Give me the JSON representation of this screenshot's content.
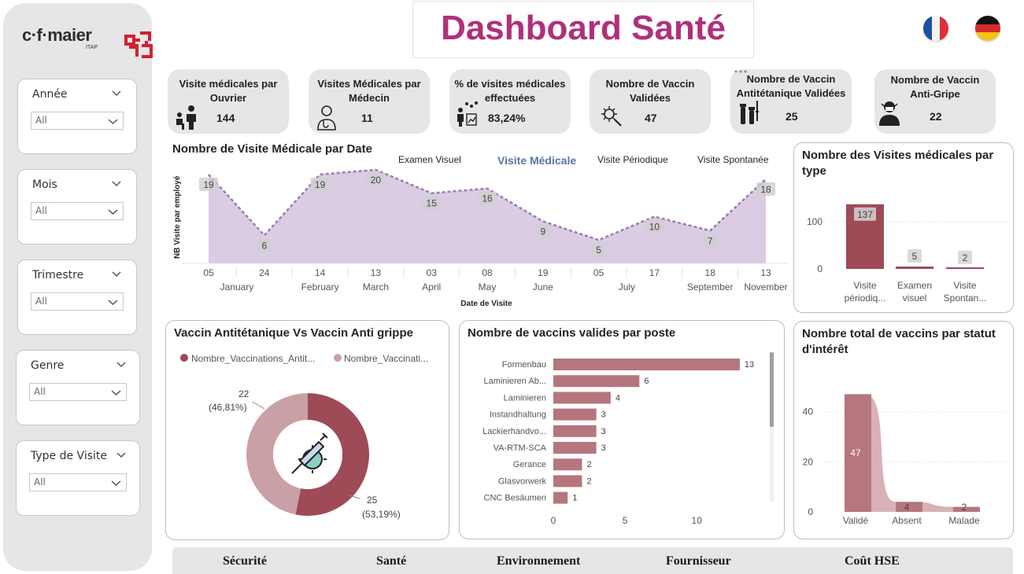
{
  "logo": {
    "brand": "c·f·maier",
    "sub": "ITAP"
  },
  "header": {
    "title": "Dashboard Santé",
    "flags": [
      "france-flag",
      "germany-flag"
    ]
  },
  "filters": [
    {
      "label": "Année",
      "value": "All"
    },
    {
      "label": "Mois",
      "value": "All"
    },
    {
      "label": "Trimestre",
      "value": "All"
    },
    {
      "label": "Genre",
      "value": "All"
    },
    {
      "label": "Type de Visite",
      "value": "All"
    }
  ],
  "kpis": [
    {
      "label": "Visite médicales par Ouvrier",
      "value": "144",
      "icon": "doctor-patient-icon"
    },
    {
      "label": "Visites Médicales par Médecin",
      "value": "11",
      "icon": "doctor-icon"
    },
    {
      "label": "% de visites médicales effectuées",
      "value": "83,24%",
      "icon": "people-chart-icon"
    },
    {
      "label": "Nombre de Vaccin Validées",
      "value": "47",
      "icon": "virus-syringe-icon"
    },
    {
      "label": "Nombre de Vaccin Antitétanique Validées",
      "value": "25",
      "icon": "vials-icon"
    },
    {
      "label": "Nombre de Vaccin Anti-Gripe",
      "value": "22",
      "icon": "sick-person-icon"
    }
  ],
  "chart_data": [
    {
      "type": "area",
      "title": "Nombre de Visite Médicale par Date",
      "xlabel": "Date de Visite",
      "ylabel": "NB Visite par employé",
      "legend_title": "Visite Médicale",
      "legend_items": [
        "Examen Visuel",
        "Visite Périodique",
        "Visite Spontanée"
      ],
      "color": "#9b7bb0",
      "x_days": [
        "05",
        "24",
        "14",
        "13",
        "03",
        "08",
        "19",
        "05",
        "17",
        "18",
        "13"
      ],
      "x_months": [
        "January",
        "",
        "February",
        "March",
        "April",
        "May",
        "June",
        "",
        "July",
        "September",
        "November"
      ],
      "values": [
        19,
        6,
        19,
        20,
        15,
        16,
        9,
        5,
        10,
        7,
        18
      ],
      "ylim": [
        0,
        22
      ]
    },
    {
      "type": "bar",
      "title": "Nombre des Visites médicales par type",
      "categories": [
        "Visite périodiq...",
        "Examen visuel",
        "Visite Spontan..."
      ],
      "values": [
        137,
        5,
        2
      ],
      "y_ticks": [
        "0",
        "100"
      ],
      "ylim": [
        0,
        150
      ],
      "color": "#9e4a57"
    },
    {
      "type": "pie",
      "title": "Vaccin Antitétanique Vs Vaccin Anti grippe",
      "legend": [
        "Nombre_Vaccinations_Antit...",
        "Nombre_Vaccinati..."
      ],
      "values": [
        25,
        22
      ],
      "labels": [
        "25",
        "22"
      ],
      "percent_labels": [
        "(53,19%)",
        "(46,81%)"
      ],
      "colors": [
        "#9e4a57",
        "#c9a0a6"
      ]
    },
    {
      "type": "bar",
      "orientation": "horizontal",
      "title": "Nombre de vaccins valides par poste",
      "categories": [
        "Formenbau",
        "Laminieren Ab...",
        "Laminieren",
        "Instandhaltung",
        "Lackierhandvo...",
        "VA-RTM-SCA",
        "Gerance",
        "Glasvorwerk",
        "CNC Besäumen"
      ],
      "values": [
        13,
        6,
        4,
        3,
        3,
        3,
        2,
        2,
        1
      ],
      "x_ticks": [
        "0",
        "5",
        "10"
      ],
      "xlim": [
        0,
        13.5
      ],
      "color": "#b5767e"
    },
    {
      "type": "bar",
      "title": "Nombre total de vaccins par statut d'intérêt",
      "categories": [
        "Validé",
        "Absent",
        "Malade"
      ],
      "values": [
        47,
        4,
        2
      ],
      "y_ticks": [
        "0",
        "20",
        "40"
      ],
      "ylim": [
        0,
        54
      ],
      "color": "#b5767e",
      "ribbon_color": "#d4a9ae"
    }
  ],
  "nav": [
    "Sécurité",
    "Santé",
    "Environnement",
    "Fournisseur",
    "Coût HSE"
  ]
}
